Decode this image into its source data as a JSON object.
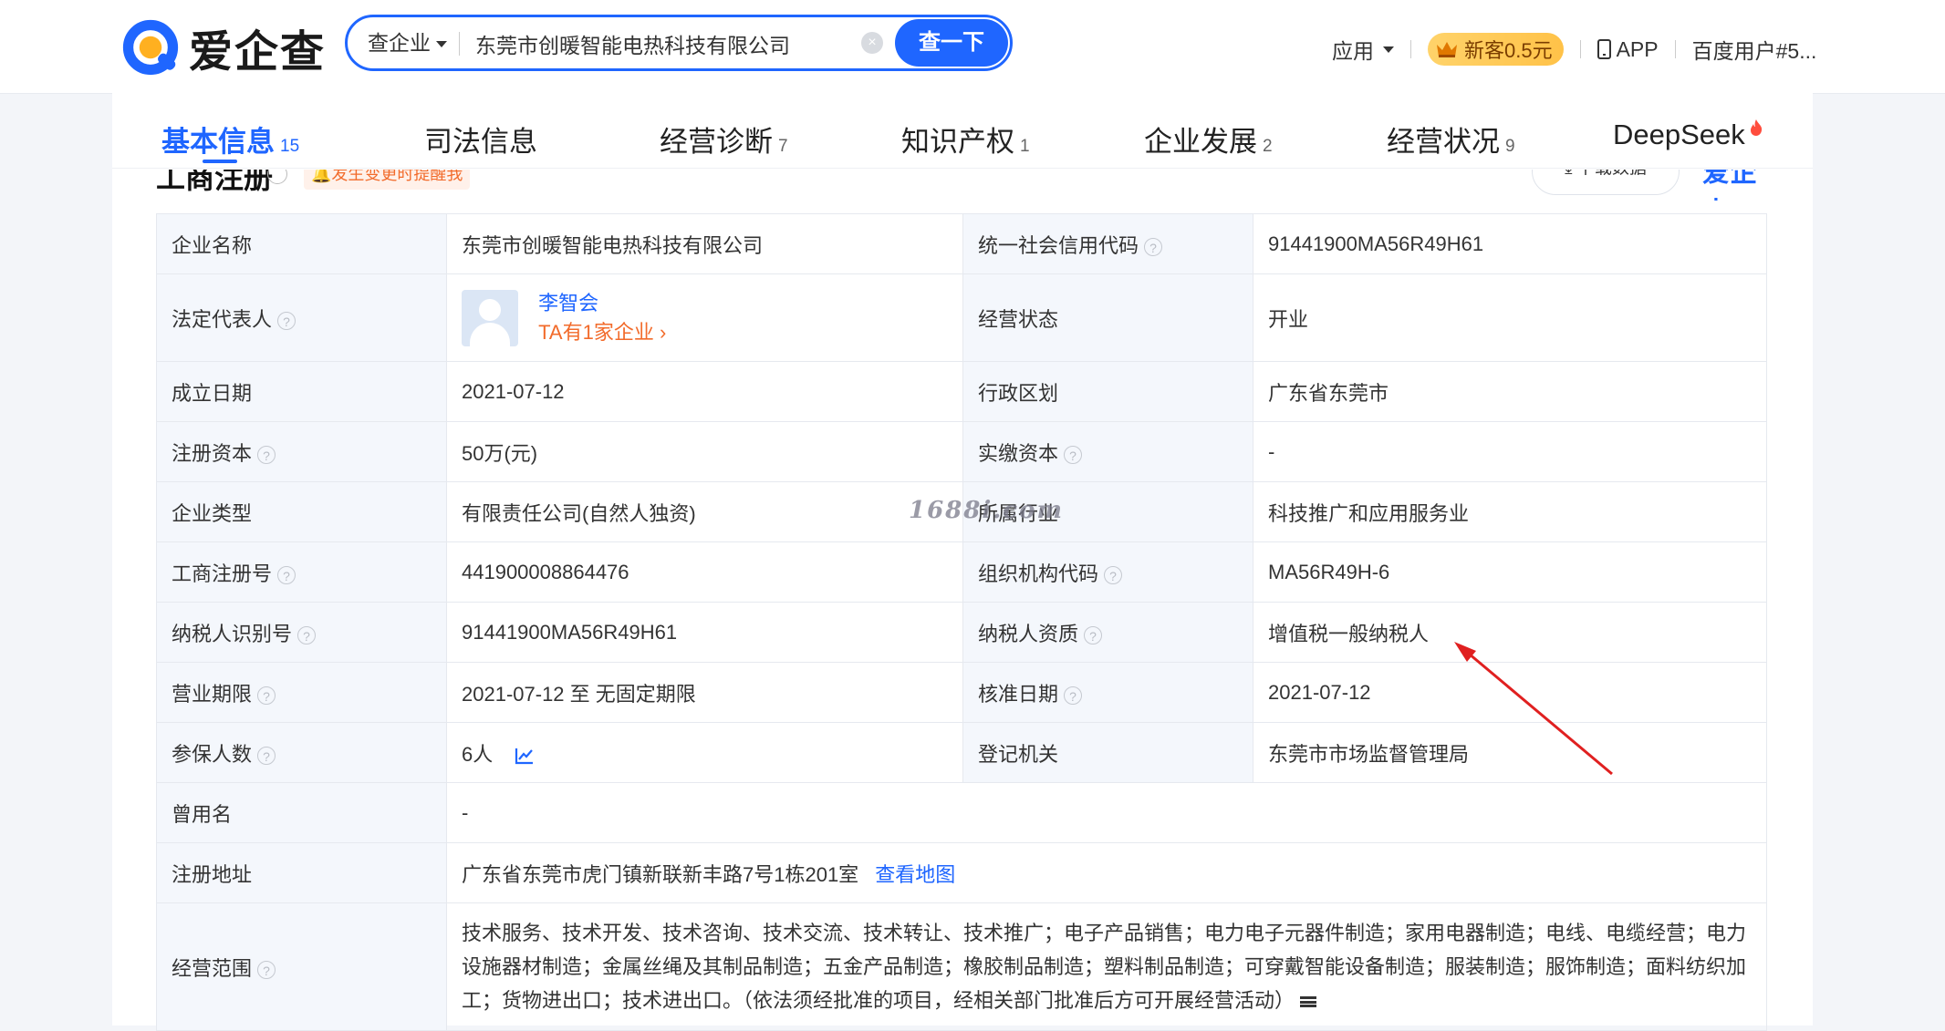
{
  "header": {
    "logo_text": "爱企查",
    "search": {
      "type": "查企业",
      "value": "东莞市创暖智能电热科技有限公司",
      "clear": "×",
      "button": "查一下"
    },
    "apps": "应用",
    "vip": "新客0.5元",
    "app_download": "APP",
    "user": "百度用户#5..."
  },
  "tabs": [
    {
      "label": "基本信息",
      "count": "15",
      "active": true
    },
    {
      "label": "司法信息",
      "count": ""
    },
    {
      "label": "经营诊断",
      "count": "7"
    },
    {
      "label": "知识产权",
      "count": "1"
    },
    {
      "label": "企业发展",
      "count": "2"
    },
    {
      "label": "经营状况",
      "count": "9"
    },
    {
      "label": "DeepSeek",
      "count": ""
    }
  ],
  "section": {
    "title": "工商注册",
    "remind": "发生变更时提醒我",
    "download": "下载数据",
    "watermark_logo": "爱企查"
  },
  "rows": {
    "company_name": {
      "label": "企业名称",
      "value": "东莞市创暖智能电热科技有限公司"
    },
    "credit_code": {
      "label": "统一社会信用代码",
      "value": "91441900MA56R49H61"
    },
    "legal_rep": {
      "label": "法定代表人",
      "name": "李智会",
      "sub": "TA有1家企业 ›"
    },
    "status": {
      "label": "经营状态",
      "value": "开业"
    },
    "founded": {
      "label": "成立日期",
      "value": "2021-07-12"
    },
    "region": {
      "label": "行政区划",
      "value": "广东省东莞市"
    },
    "reg_capital": {
      "label": "注册资本",
      "value": "50万(元)"
    },
    "paid_capital": {
      "label": "实缴资本",
      "value": "-"
    },
    "company_type": {
      "label": "企业类型",
      "value": "有限责任公司(自然人独资)"
    },
    "industry": {
      "label": "所属行业",
      "value": "科技推广和应用服务业"
    },
    "reg_no": {
      "label": "工商注册号",
      "value": "441900008864476"
    },
    "org_code": {
      "label": "组织机构代码",
      "value": "MA56R49H-6"
    },
    "tax_id": {
      "label": "纳税人识别号",
      "value": "91441900MA56R49H61"
    },
    "tax_qual": {
      "label": "纳税人资质",
      "value": "增值税一般纳税人"
    },
    "term": {
      "label": "营业期限",
      "value": "2021-07-12 至 无固定期限"
    },
    "approval_date": {
      "label": "核准日期",
      "value": "2021-07-12"
    },
    "insured": {
      "label": "参保人数",
      "value": "6人"
    },
    "authority": {
      "label": "登记机关",
      "value": "东莞市市场监督管理局"
    },
    "former_name": {
      "label": "曾用名",
      "value": "-"
    },
    "address": {
      "label": "注册地址",
      "value": "广东省东莞市虎门镇新联新丰路7号1栋201室",
      "link": "查看地图"
    },
    "scope": {
      "label": "经营范围",
      "value": "技术服务、技术开发、技术咨询、技术交流、技术转让、技术推广；电子产品销售；电力电子元器件制造；家用电器制造；电线、电缆经营；电力设施器材制造；金属丝绳及其制品制造；五金产品制造；橡胶制品制造；塑料制品制造；可穿戴智能设备制造；服装制造；服饰制造；面料纺织加工；货物进出口；技术进出口。（依法须经批准的项目，经相关部门批准后方可开展经营活动）"
    }
  },
  "watermark": "1688i.com",
  "colors": {
    "brand": "#1f66ff",
    "accent": "#f26b2b",
    "label_bg": "#f4f7fc",
    "arrow": "#e02020"
  }
}
